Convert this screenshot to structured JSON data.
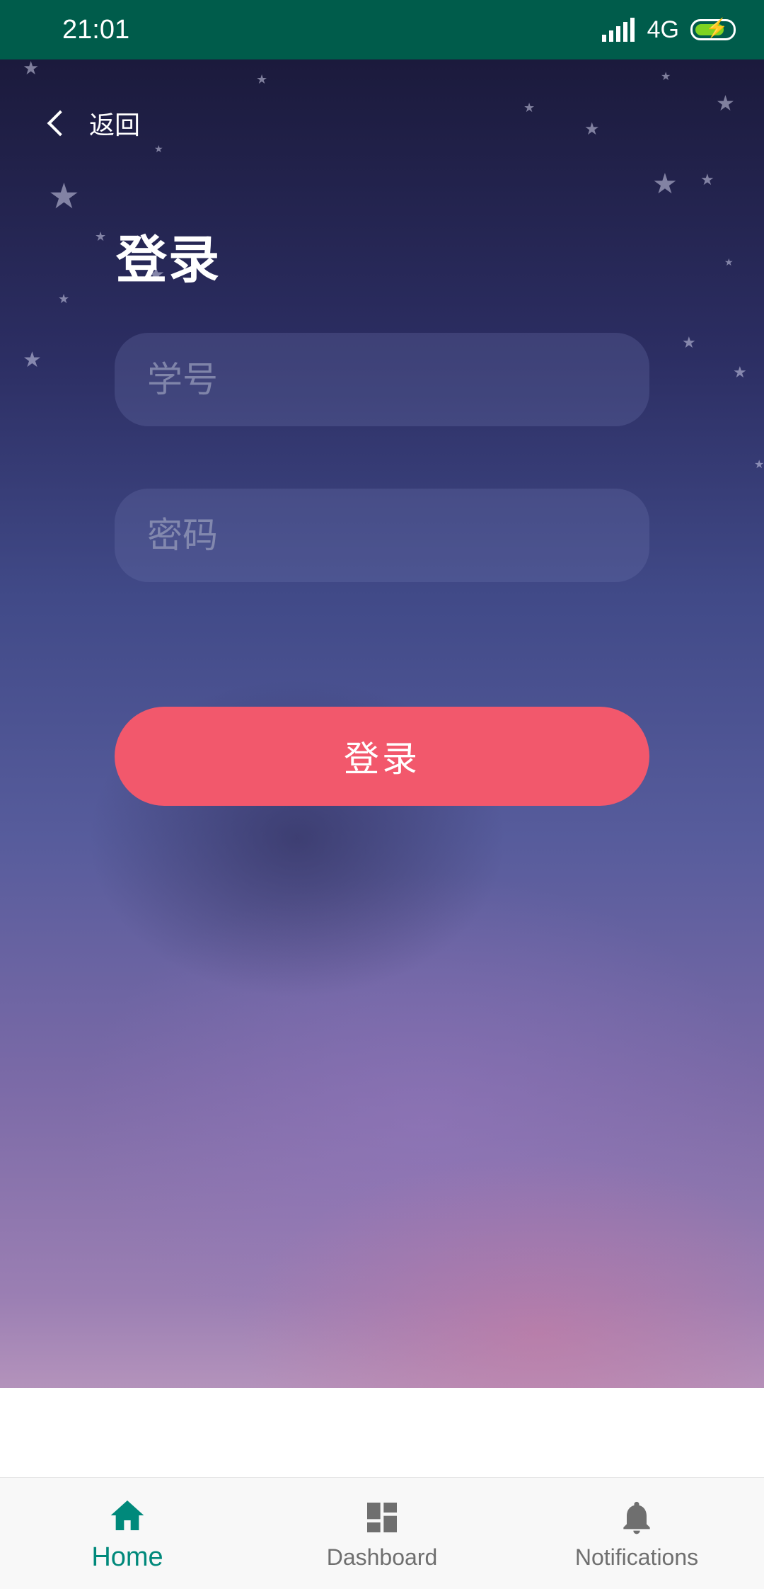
{
  "status_bar": {
    "time": "21:01",
    "network": "4G",
    "signal_icon": "signal-icon",
    "battery_icon": "battery-charging-icon",
    "battery_color": "#7ed321"
  },
  "header": {
    "back_label": "返回",
    "back_icon": "chevron-left-icon"
  },
  "login": {
    "title": "登录",
    "student_id_placeholder": "学号",
    "password_placeholder": "密码",
    "submit_label": "登录",
    "button_color": "#f2586c"
  },
  "bottom_nav": {
    "items": [
      {
        "label": "Home",
        "icon": "home-icon",
        "active": true
      },
      {
        "label": "Dashboard",
        "icon": "dashboard-icon",
        "active": false
      },
      {
        "label": "Notifications",
        "icon": "bell-icon",
        "active": false
      }
    ],
    "active_color": "#00897b",
    "inactive_color": "#6f6f6f"
  },
  "theme": {
    "status_bar_bg": "#005c4b",
    "background_top": "#1b1a3c",
    "background_bottom": "#b896bd"
  }
}
